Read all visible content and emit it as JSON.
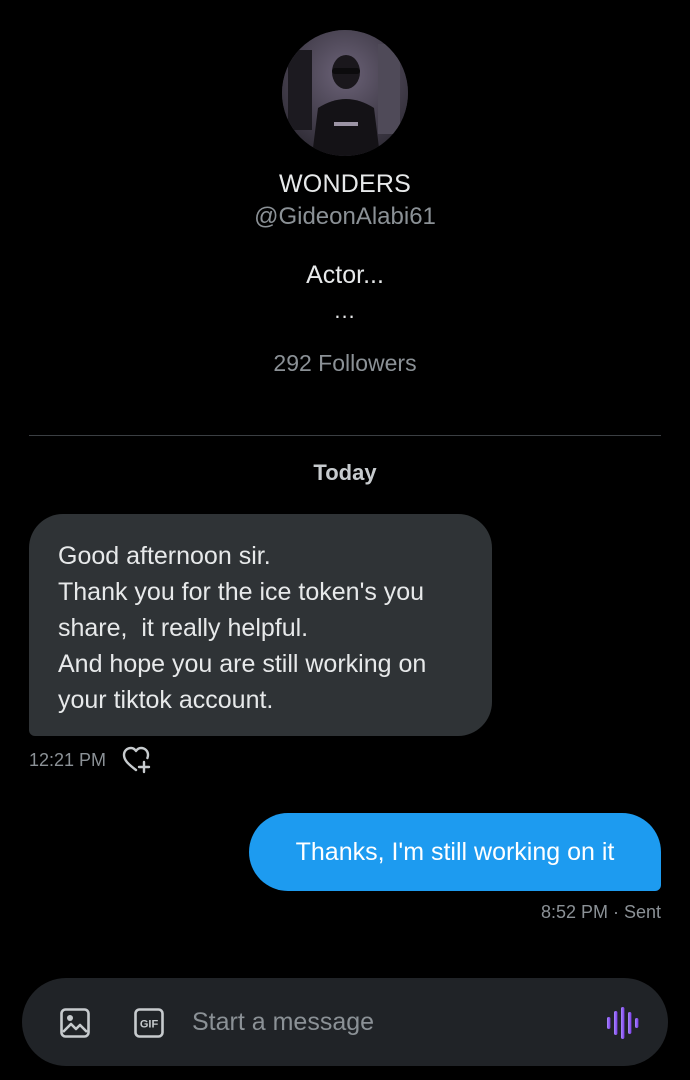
{
  "profile": {
    "name": "WONDERS",
    "handle": "@GideonAlabi61",
    "bio": "Actor...",
    "bio_more": "...",
    "followers": "292 Followers"
  },
  "conversation": {
    "date_separator": "Today",
    "messages": [
      {
        "direction": "incoming",
        "lines": [
          "Good afternoon sir.",
          "Thank you for the ice token's you",
          "share,  it really helpful.",
          "And hope you are still working on",
          "your tiktok account."
        ],
        "time": "12:21 PM"
      },
      {
        "direction": "outgoing",
        "text": "Thanks, I'm still working on it",
        "time_status": "8:52 PM · Sent"
      }
    ]
  },
  "composer": {
    "placeholder": "Start a message",
    "image_icon": "image-icon",
    "gif_icon": "gif-icon",
    "voice_icon": "voice-waveform-icon"
  },
  "colors": {
    "background": "#000000",
    "incoming_bubble": "#2f3336",
    "outgoing_bubble": "#1d9bf0",
    "accent_voice": "#8b5cf6",
    "muted_text": "#8b9196"
  }
}
